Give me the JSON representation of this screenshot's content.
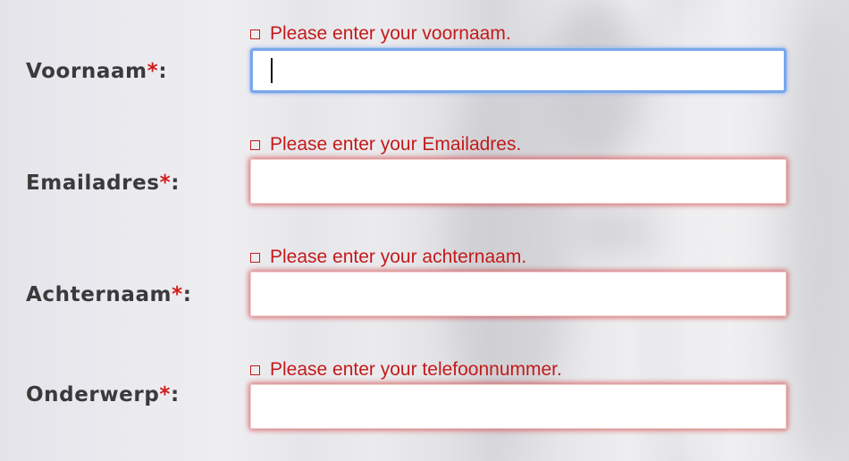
{
  "form": {
    "fields": [
      {
        "label": "Voornaam",
        "required_marker": "*",
        "colon": ":",
        "error": "Please enter your voornaam.",
        "value": "",
        "focused": true
      },
      {
        "label": "Emailadres",
        "required_marker": "*",
        "colon": ":",
        "error": "Please enter your Emailadres.",
        "value": "",
        "focused": false
      },
      {
        "label": "Achternaam",
        "required_marker": "*",
        "colon": ":",
        "error": "Please enter your achternaam.",
        "value": "",
        "focused": false
      },
      {
        "label": "Onderwerp",
        "required_marker": "*",
        "colon": ":",
        "error": "Please enter your telefoonnummer.",
        "value": "",
        "focused": false
      }
    ]
  },
  "colors": {
    "error_red": "#c41a1a",
    "required_star": "#d11d1d",
    "label_text": "#3a3a3a",
    "focus_blue": "#7aa7ea"
  },
  "icons": {
    "error_marker": "error-checkbox-icon"
  }
}
